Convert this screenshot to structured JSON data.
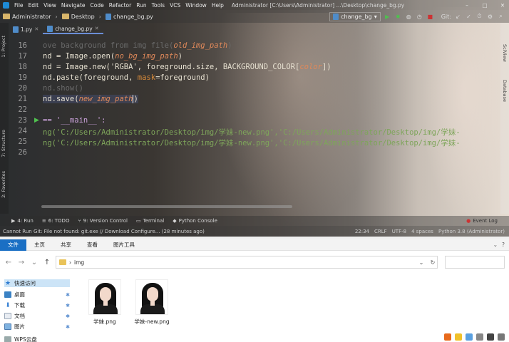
{
  "ide": {
    "menu": [
      "File",
      "Edit",
      "View",
      "Navigate",
      "Code",
      "Refactor",
      "Run",
      "Tools",
      "VCS",
      "Window",
      "Help"
    ],
    "window_title": "Administrator [C:\\Users\\Administrator] ...\\Desktop\\change_bg.py",
    "breadcrumbs": [
      "Administrator",
      "Desktop",
      "change_bg.py"
    ],
    "run_config": "change_bg",
    "git_label": "Git:",
    "left_tabs": [
      "1: Project",
      "7: Structure",
      "2: Favorites"
    ],
    "right_tabs": [
      "SciView",
      "Database"
    ],
    "tabs": [
      {
        "label": "1.py",
        "active": false
      },
      {
        "label": "change_bg.py",
        "active": true
      }
    ],
    "line_numbers": [
      "16",
      "17",
      "18",
      "19",
      "20",
      "21",
      "22",
      "23",
      "24",
      "25",
      "26"
    ],
    "code": {
      "l16_a": "ove background from img file(",
      "l16_b": "old_img_path",
      "l16_c": ")",
      "l17_a": "nd = Image.open(",
      "l17_b": "no_bg_img_path",
      "l17_c": ")",
      "l18_a": "nd = Image.new('RGBA', foreground.size, BACKGROUND_COLOR[",
      "l18_b": "color",
      "l18_c": "])",
      "l19_a": "nd.paste(foreground, ",
      "l19_b": "mask",
      "l19_c": "=foreground)",
      "l20": "nd.show()",
      "l21_a": "nd.save(",
      "l21_b": "new_img_path",
      "l21_c": ")",
      "l23_a": "== '__main__':",
      "l25": "ng('C:/Users/Administrator/Desktop/img/学妹-new.png','C:/Users/Administrator/Desktop/img/学妹-",
      "l26": "ng('C:/Users/Administrator/Desktop/img/学妹-new.png','C:/Users/Administrator/Desktop/img/学妹-"
    },
    "bottom_tools": [
      "4: Run",
      "6: TODO",
      "9: Version Control",
      "Terminal",
      "Python Console"
    ],
    "event_log": "Event Log",
    "status_message": "Cannot Run Git: File not found: git.exe // Download   Configure...  (28 minutes ago)",
    "status_right": [
      "22:34",
      "CRLF",
      "UTF-8",
      "4 spaces",
      "Python 3.8 (Administrator)"
    ]
  },
  "explorer": {
    "ribbon_tabs": [
      "文件",
      "主页",
      "共享",
      "查看",
      "图片工具"
    ],
    "address": "img",
    "nav": [
      {
        "label": "快速访问",
        "icon": "star-icon",
        "pinned": false
      },
      {
        "label": "桌面",
        "icon": "desktop-icon",
        "pinned": true
      },
      {
        "label": "下载",
        "icon": "download-icon",
        "pinned": true
      },
      {
        "label": "文档",
        "icon": "document-icon",
        "pinned": true
      },
      {
        "label": "图片",
        "icon": "pictures-icon",
        "pinned": true
      },
      {
        "label": "WPS云盘",
        "icon": "cloud-drive-icon",
        "pinned": false
      }
    ],
    "files": [
      {
        "name": "学妹.png"
      },
      {
        "name": "学妹-new.png"
      }
    ]
  },
  "colors": {
    "file_tab": "#1a6fc4",
    "keyword": "#d98b3a",
    "string": "#7ea55a",
    "param": "#e0895a",
    "run_green": "#4fc04f"
  }
}
